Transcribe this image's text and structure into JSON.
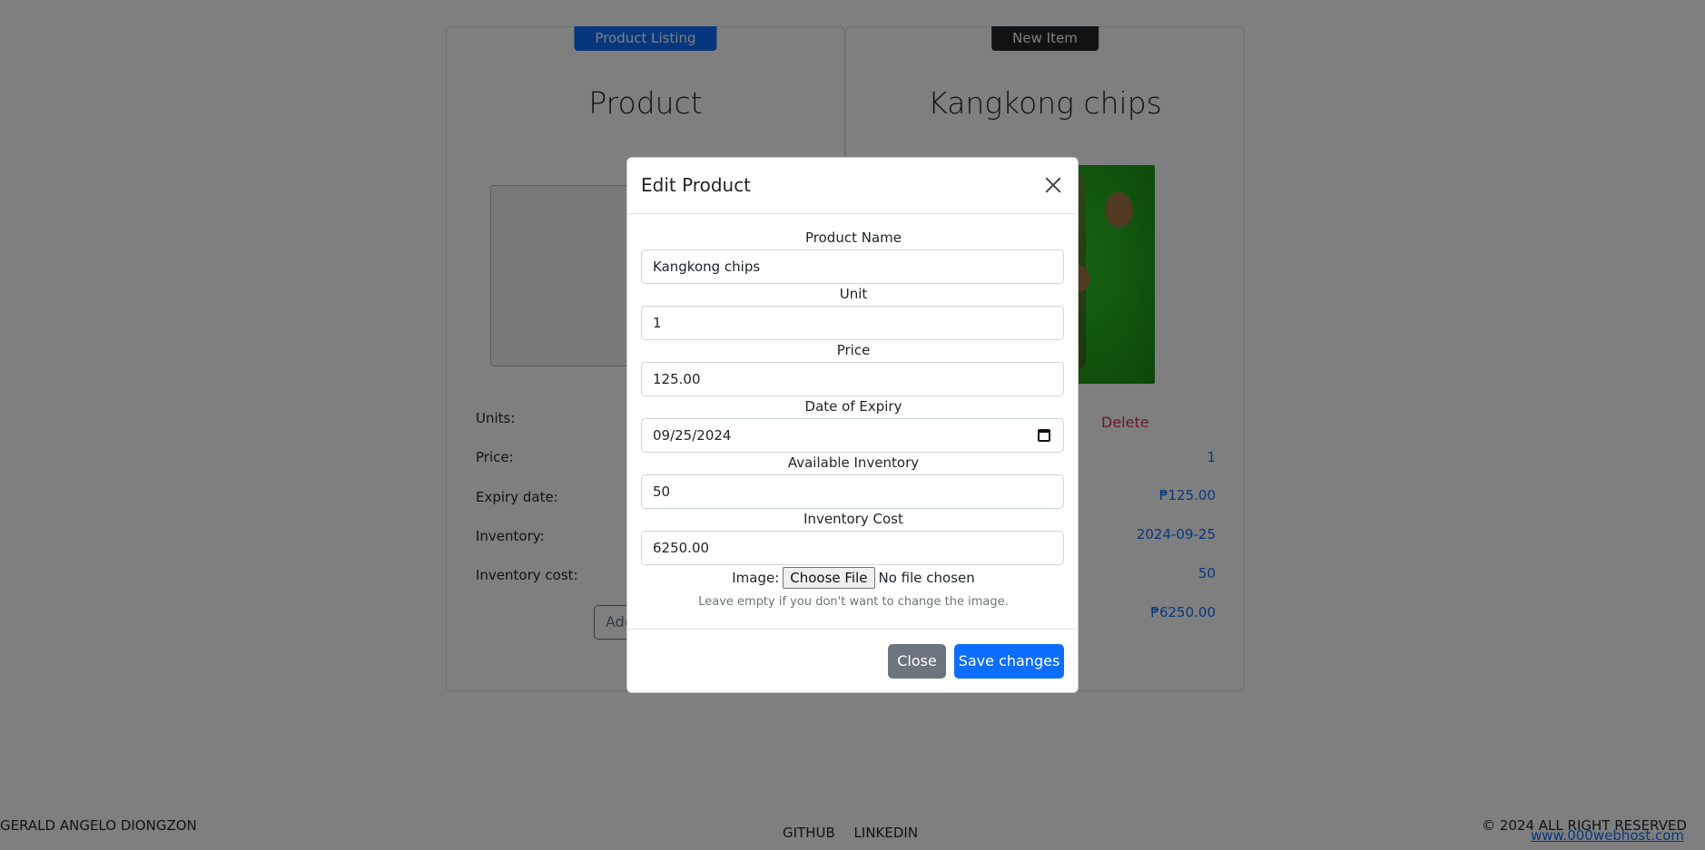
{
  "left_card": {
    "tag": "Product Listing",
    "title": "Product",
    "labels": [
      "Units:",
      "Price:",
      "Expiry date:",
      "Inventory:",
      "Inventory cost:"
    ],
    "add_button": "Add"
  },
  "right_card": {
    "tag": "New Item",
    "title": "Kangkong chips",
    "delete": "Delete",
    "values": [
      "1",
      "₱125.00",
      "2024-09-25",
      "50",
      "₱6250.00"
    ]
  },
  "modal": {
    "title": "Edit Product",
    "fields": [
      {
        "label": "Product Name",
        "value": "Kangkong chips"
      },
      {
        "label": "Unit",
        "value": "1"
      },
      {
        "label": "Price",
        "value": "125.00"
      },
      {
        "label": "Date of Expiry",
        "value": "09/25/2024"
      },
      {
        "label": "Available Inventory",
        "value": "50"
      },
      {
        "label": "Inventory Cost",
        "value": "6250.00"
      }
    ],
    "image_label": "Image:",
    "choose_file": "Choose File",
    "no_file": "No file chosen",
    "help": "Leave empty if you don't want to change the image.",
    "close_button": "Close",
    "save_button": "Save changes"
  },
  "footer": {
    "name": "GERALD ANGELO DIONGZON",
    "links": [
      "GITHUB",
      "LINKEDIN"
    ],
    "copyright": "© 2024 ALL RIGHT RESERVED",
    "host": "www.000webhost.com"
  }
}
